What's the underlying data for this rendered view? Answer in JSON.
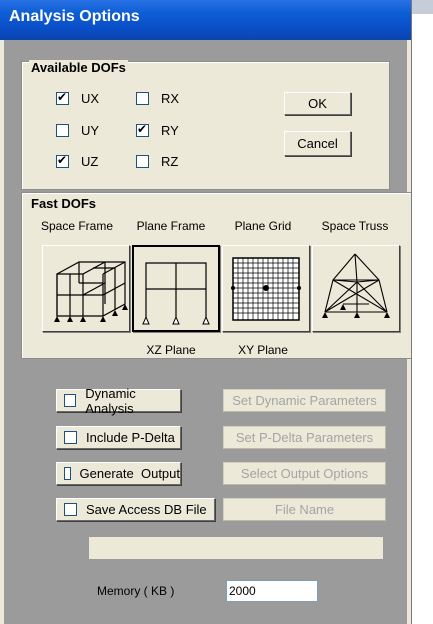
{
  "window": {
    "title": "Analysis Options"
  },
  "available_dofs": {
    "label": "Available DOFs",
    "items": [
      {
        "label": "UX",
        "checked": true
      },
      {
        "label": "RX",
        "checked": false
      },
      {
        "label": "UY",
        "checked": false
      },
      {
        "label": "RY",
        "checked": true
      },
      {
        "label": "UZ",
        "checked": true
      },
      {
        "label": "RZ",
        "checked": false
      }
    ]
  },
  "buttons": {
    "ok": "OK",
    "cancel": "Cancel"
  },
  "fast_dofs": {
    "label": "Fast DOFs",
    "options": [
      {
        "label": "Space Frame",
        "icon": "space-frame-icon"
      },
      {
        "label": "Plane Frame",
        "icon": "plane-frame-icon",
        "selected": true
      },
      {
        "label": "Plane Grid",
        "icon": "plane-grid-icon"
      },
      {
        "label": "Space Truss",
        "icon": "space-truss-icon"
      }
    ],
    "captions": {
      "xz": "XZ Plane",
      "xy": "XY Plane"
    }
  },
  "options": [
    {
      "label": "Dynamic Analysis",
      "checked": false,
      "action": "Set Dynamic Parameters"
    },
    {
      "label": "Include P-Delta",
      "checked": false,
      "action": "Set P-Delta Parameters"
    },
    {
      "label": "Generate  Output",
      "checked": false,
      "action": "Select Output Options"
    },
    {
      "label": "Save Access DB File",
      "checked": false,
      "action": "File Name"
    }
  ],
  "memory": {
    "label": "Memory ( KB )",
    "value": "2000"
  }
}
